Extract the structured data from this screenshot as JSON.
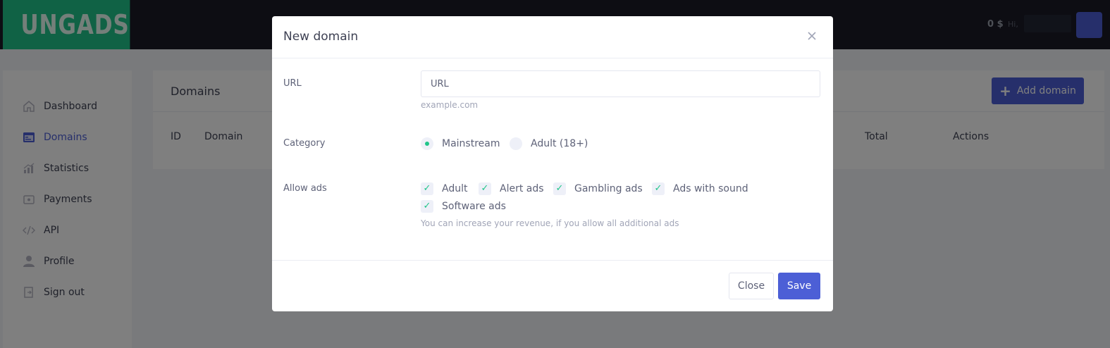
{
  "app": {
    "logo": "UNGADS",
    "balance": "0 $",
    "greeting": "Hi,"
  },
  "sidebar": {
    "items": [
      {
        "label": "Dashboard",
        "icon": "home-icon"
      },
      {
        "label": "Domains",
        "icon": "browser-window-icon",
        "active": true
      },
      {
        "label": "Statistics",
        "icon": "chart-icon"
      },
      {
        "label": "Payments",
        "icon": "wallet-icon"
      },
      {
        "label": "API",
        "icon": "code-icon"
      },
      {
        "label": "Profile",
        "icon": "user-icon"
      },
      {
        "label": "Sign out",
        "icon": "sign-out-icon"
      }
    ]
  },
  "page": {
    "title": "Domains",
    "add_button": "Add domain",
    "table_headers": [
      "ID",
      "Domain",
      "Total",
      "Actions"
    ]
  },
  "modal": {
    "title": "New domain",
    "url_label": "URL",
    "url_placeholder": "URL",
    "url_hint": "example.com",
    "category_label": "Category",
    "categories": [
      {
        "label": "Mainstream",
        "selected": true
      },
      {
        "label": "Adult (18+)",
        "selected": false
      }
    ],
    "allow_ads_label": "Allow ads",
    "ad_types": [
      {
        "label": "Adult",
        "checked": true
      },
      {
        "label": "Alert ads",
        "checked": true
      },
      {
        "label": "Gambling ads",
        "checked": true
      },
      {
        "label": "Ads with sound",
        "checked": true
      },
      {
        "label": "Software ads",
        "checked": true
      }
    ],
    "ads_hint": "You can increase your revenue, if you allow all additional ads",
    "close_button": "Close",
    "save_button": "Save"
  },
  "colors": {
    "brand_green": "#20c58a",
    "primary": "#4c5fd6",
    "topbar": "#1a1a27"
  }
}
